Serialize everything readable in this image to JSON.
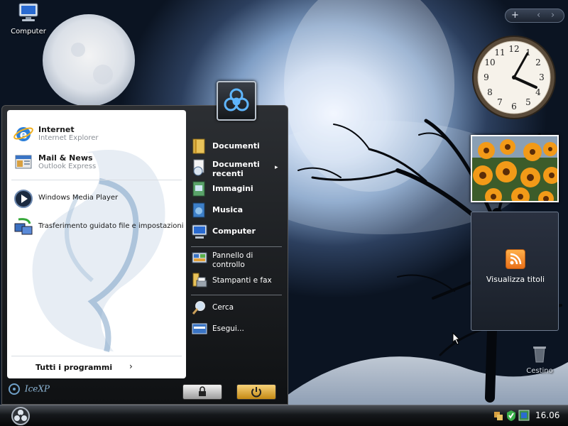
{
  "desktop": {
    "icons": [
      {
        "name": "computer",
        "label": "Computer",
        "icon": "computer-icon"
      },
      {
        "name": "recycle-bin",
        "label": "Cestino",
        "icon": "recycle-bin-icon"
      }
    ]
  },
  "sidebar": {
    "add_glyph": "+",
    "prev_glyph": "‹",
    "next_glyph": "›",
    "clock_time": "16:06",
    "feed_label": "Visualizza titoli"
  },
  "start_menu": {
    "pinned": [
      {
        "title": "Internet",
        "subtitle": "Internet Explorer",
        "icon": "internet-explorer-icon"
      },
      {
        "title": "Mail & News",
        "subtitle": "Outlook Express",
        "icon": "outlook-express-icon"
      }
    ],
    "recent": [
      {
        "title": "Windows Media Player",
        "icon": "media-player-icon"
      },
      {
        "title": "Trasferimento guidato file e impostazioni",
        "icon": "transfer-wizard-icon"
      }
    ],
    "all_programs": "Tutti i programmi",
    "all_programs_arrow": "›",
    "right": {
      "documents": "Documenti",
      "recent_documents": "Documenti recenti",
      "pictures": "Immagini",
      "music": "Musica",
      "computer": "Computer",
      "control_panel": "Pannello di controllo",
      "printers": "Stampanti e fax",
      "search": "Cerca",
      "run": "Esegui..."
    },
    "submenu_arrow": "▸",
    "brand": "IceXP",
    "lock_button": "lock-icon",
    "power_button": "power-icon"
  },
  "taskbar": {
    "clock": "16.06",
    "tray_icons": [
      "network-icon",
      "security-icon",
      "volume-icon"
    ]
  },
  "colors": {
    "start_menu_bg": "#1c1f22",
    "power_accent": "#e0a52a",
    "feed_accent": "#f28a2e"
  }
}
